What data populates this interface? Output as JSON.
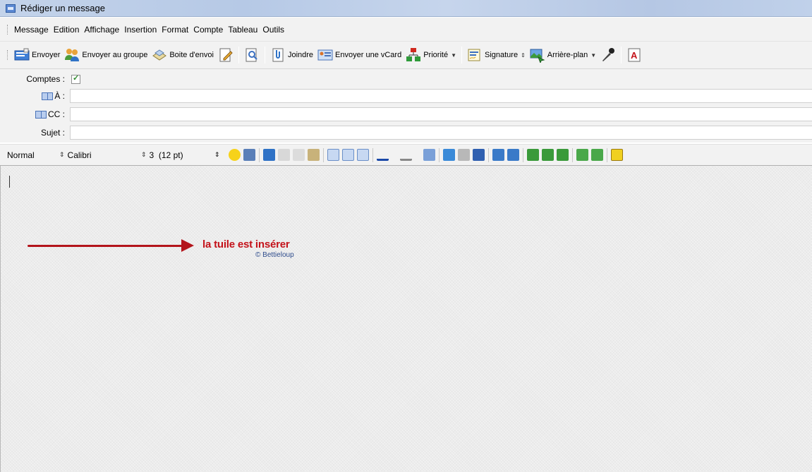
{
  "window": {
    "title": "Rédiger un message"
  },
  "menu": [
    "Message",
    "Edition",
    "Affichage",
    "Insertion",
    "Format",
    "Compte",
    "Tableau",
    "Outils"
  ],
  "toolbar": {
    "send": "Envoyer",
    "send_group": "Envoyer au groupe",
    "outbox": "Boite d'envoi",
    "attach": "Joindre",
    "vcard": "Envoyer une vCard",
    "priority": "Priorité",
    "signature": "Signature",
    "background": "Arrière-plan"
  },
  "fields": {
    "accounts_label": "Comptes :",
    "accounts_checked": true,
    "to_label": "À :",
    "cc_label": "CC :",
    "subject_label": "Sujet :",
    "to_value": "",
    "cc_value": "",
    "subject_value": ""
  },
  "format": {
    "paragraph_style": "Normal",
    "font": "Calibri",
    "size": "3  (12 pt)"
  },
  "body": {
    "caption": "la tuile est insérer",
    "credit": "© Bettieloup"
  },
  "colors": {
    "accent_red": "#c4121a",
    "credit_blue": "#2e4c8c",
    "chrome": "#f2f2f2"
  }
}
